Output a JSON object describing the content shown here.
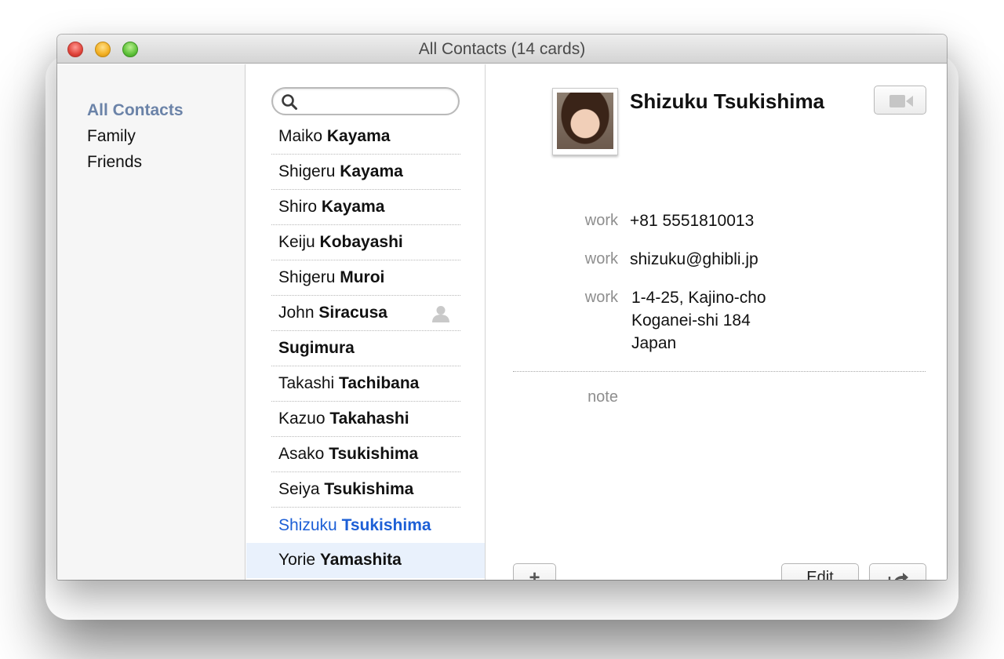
{
  "window": {
    "title": "All Contacts (14 cards)"
  },
  "groups": {
    "items": [
      {
        "label": "All Contacts",
        "active": true
      },
      {
        "label": "Family",
        "active": false
      },
      {
        "label": "Friends",
        "active": false
      }
    ]
  },
  "search": {
    "value": "",
    "placeholder": ""
  },
  "contacts": [
    {
      "first": "Maiko",
      "last": "Kayama"
    },
    {
      "first": "Shigeru",
      "last": "Kayama"
    },
    {
      "first": "Shiro",
      "last": "Kayama"
    },
    {
      "first": "Keiju",
      "last": "Kobayashi"
    },
    {
      "first": "Shigeru",
      "last": "Muroi"
    },
    {
      "first": "John",
      "last": "Siracusa",
      "is_me": true
    },
    {
      "first": "",
      "last": "Sugimura"
    },
    {
      "first": "Takashi",
      "last": "Tachibana"
    },
    {
      "first": "Kazuo",
      "last": "Takahashi"
    },
    {
      "first": "Asako",
      "last": "Tsukishima"
    },
    {
      "first": "Seiya",
      "last": "Tsukishima"
    },
    {
      "first": "Shizuku",
      "last": "Tsukishima",
      "selected": true
    },
    {
      "first": "Yorie",
      "last": "Yamashita"
    }
  ],
  "card": {
    "name": "Shizuku Tsukishima",
    "phone": {
      "label": "work",
      "value": "+81 5551810013"
    },
    "email": {
      "label": "work",
      "value": "shizuku@ghibli.jp"
    },
    "address": {
      "label": "work",
      "line1": "1-4-25, Kajino-cho",
      "line2": "Koganei-shi 184",
      "line3": "Japan"
    },
    "note_label": "note"
  },
  "buttons": {
    "add_label": "+",
    "edit_label": "Edit"
  },
  "colors": {
    "group_active": "#6b83a8",
    "selected_text": "#1d5fd6",
    "selected_bg": "#e9f1fc"
  },
  "icons": {
    "search": "magnifier-icon",
    "me": "person-silhouette-icon",
    "facetime": "video-camera-icon",
    "share": "share-arrow-icon"
  }
}
